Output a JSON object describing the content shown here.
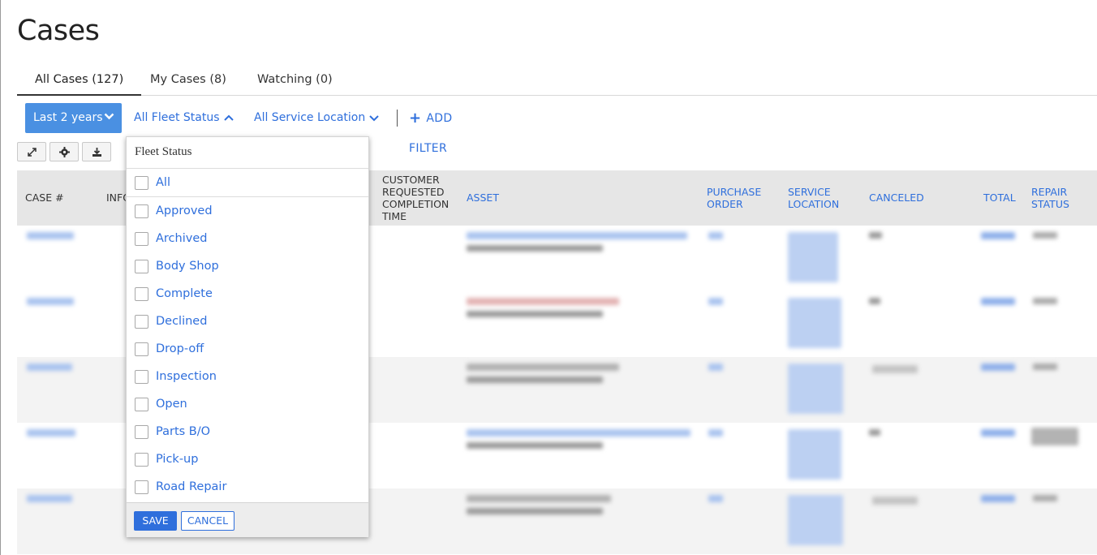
{
  "page": {
    "title": "Cases"
  },
  "tabs": [
    {
      "label": "All Cases (127)",
      "active": true
    },
    {
      "label": "My Cases (8)",
      "active": false
    },
    {
      "label": "Watching (0)",
      "active": false
    }
  ],
  "filters": {
    "date_range": "Last 2 years",
    "fleet_status": "All Fleet Status",
    "service_location": "All Service Location",
    "add_filter": "ADD FILTER"
  },
  "toolbar": {
    "expand_icon": "expand-icon",
    "settings_icon": "gear-icon",
    "download_icon": "download-icon"
  },
  "table": {
    "headers": {
      "case_no": "CASE #",
      "info": "INFO",
      "customer_requested": "CUSTOMER REQUESTED COMPLETION TIME",
      "asset": "ASSET",
      "purchase_order": "PURCHASE ORDER",
      "service_location": "SERVICE LOCATION",
      "canceled": "CANCELED",
      "total": "TOTAL",
      "repair_status": "REPAIR STATUS"
    }
  },
  "fleet_status_dropdown": {
    "title": "Fleet Status",
    "all_label": "All",
    "options": [
      "Approved",
      "Archived",
      "Body Shop",
      "Complete",
      "Declined",
      "Drop-off",
      "Inspection",
      "Open",
      "Parts B/O",
      "Pick-up",
      "Road Repair"
    ],
    "save_label": "SAVE",
    "cancel_label": "CANCEL"
  },
  "colors": {
    "accent": "#4a90e2",
    "link": "#2f6fdc",
    "header_bg": "#e6e6e6"
  }
}
